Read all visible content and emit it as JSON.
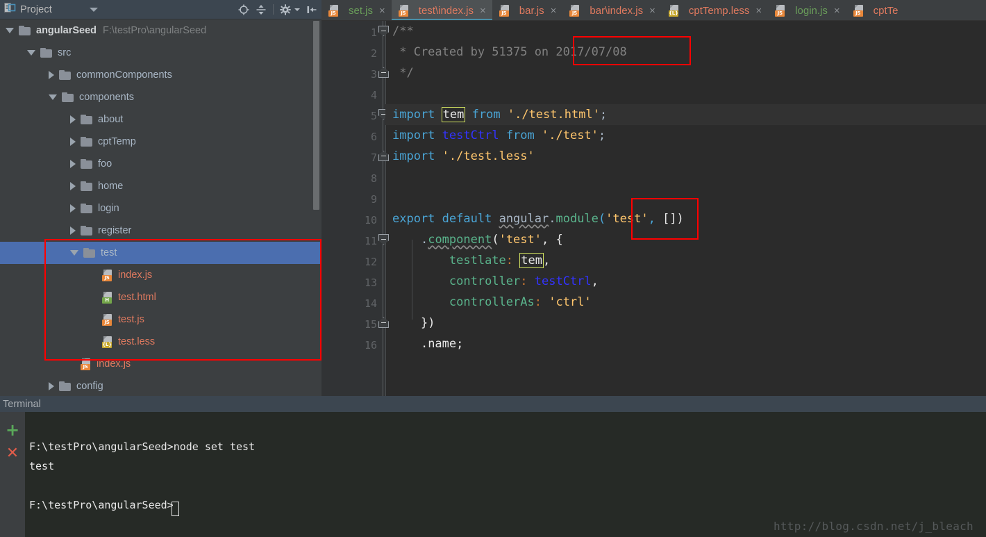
{
  "project_panel": {
    "title": "Project",
    "header_icons": [
      {
        "name": "project-view-selector-icon",
        "glyph": "▾"
      },
      {
        "name": "locate-in-tree-icon",
        "glyph": "⊕"
      },
      {
        "name": "collapse-all-icon",
        "glyph": "≕"
      },
      {
        "name": "settings-gear-icon",
        "glyph": "⚙"
      },
      {
        "name": "hide-panel-icon",
        "glyph": "⇤"
      }
    ],
    "tree": [
      {
        "label": "angularSeed",
        "path": "F:\\testPro\\angularSeed",
        "type": "project-root",
        "indent": 0,
        "state": "open",
        "icon": "folder"
      },
      {
        "label": "src",
        "type": "folder",
        "indent": 1,
        "state": "open",
        "icon": "folder"
      },
      {
        "label": "commonComponents",
        "type": "folder",
        "indent": 2,
        "state": "closed",
        "icon": "folder"
      },
      {
        "label": "components",
        "type": "folder",
        "indent": 2,
        "state": "open",
        "icon": "folder"
      },
      {
        "label": "about",
        "type": "folder",
        "indent": 3,
        "state": "closed",
        "icon": "folder"
      },
      {
        "label": "cptTemp",
        "type": "folder",
        "indent": 3,
        "state": "closed",
        "icon": "folder"
      },
      {
        "label": "foo",
        "type": "folder",
        "indent": 3,
        "state": "closed",
        "icon": "folder"
      },
      {
        "label": "home",
        "type": "folder",
        "indent": 3,
        "state": "closed",
        "icon": "folder"
      },
      {
        "label": "login",
        "type": "folder",
        "indent": 3,
        "state": "closed",
        "icon": "folder"
      },
      {
        "label": "register",
        "type": "folder",
        "indent": 3,
        "state": "closed",
        "icon": "folder"
      },
      {
        "label": "test",
        "type": "folder",
        "indent": 3,
        "state": "open",
        "icon": "folder",
        "selected": true
      },
      {
        "label": "index.js",
        "type": "file",
        "indent": 4,
        "icon": "js"
      },
      {
        "label": "test.html",
        "type": "file",
        "indent": 4,
        "icon": "html"
      },
      {
        "label": "test.js",
        "type": "file",
        "indent": 4,
        "icon": "js"
      },
      {
        "label": "test.less",
        "type": "file",
        "indent": 4,
        "icon": "less"
      },
      {
        "label": "index.js",
        "type": "file",
        "indent": 3,
        "icon": "js"
      },
      {
        "label": "config",
        "type": "folder",
        "indent": 2,
        "state": "closed",
        "icon": "folder"
      }
    ]
  },
  "editor": {
    "tabs": [
      {
        "label": "set.js",
        "icon": "js",
        "color": "green",
        "active": false,
        "closable": true
      },
      {
        "label": "test\\index.js",
        "icon": "js",
        "color": "red",
        "active": true,
        "closable": true
      },
      {
        "label": "bar.js",
        "icon": "js",
        "color": "red",
        "active": false,
        "closable": true
      },
      {
        "label": "bar\\index.js",
        "icon": "js",
        "color": "red",
        "active": false,
        "closable": true
      },
      {
        "label": "cptTemp.less",
        "icon": "less",
        "color": "red",
        "active": false,
        "closable": true
      },
      {
        "label": "login.js",
        "icon": "js",
        "color": "green",
        "active": false,
        "closable": true
      },
      {
        "label": "cptTe",
        "icon": "js",
        "color": "red",
        "active": false,
        "closable": false
      }
    ],
    "close_glyph": "×",
    "line_numbers": [
      "1",
      "2",
      "3",
      "4",
      "5",
      "6",
      "7",
      "8",
      "9",
      "10",
      "11",
      "12",
      "13",
      "14",
      "15",
      "16"
    ],
    "current_line": 5,
    "lines": [
      {
        "n": 1,
        "text": "/**"
      },
      {
        "n": 2,
        "text": " * Created by 51375 on 2017/07/08"
      },
      {
        "n": 3,
        "text": " */"
      },
      {
        "n": 4,
        "text": ""
      },
      {
        "n": 5,
        "text": "import tem from './test.html';"
      },
      {
        "n": 6,
        "text": "import testCtrl from './test';"
      },
      {
        "n": 7,
        "text": "import './test.less'"
      },
      {
        "n": 8,
        "text": ""
      },
      {
        "n": 9,
        "text": ""
      },
      {
        "n": 10,
        "text": "export default angular.module('test', [])"
      },
      {
        "n": 11,
        "text": "    .component('test', {"
      },
      {
        "n": 12,
        "text": "        testlate: tem,"
      },
      {
        "n": 13,
        "text": "        controller: testCtrl,"
      },
      {
        "n": 14,
        "text": "        controllerAs: 'ctrl'"
      },
      {
        "n": 15,
        "text": "    })"
      },
      {
        "n": 16,
        "text": "    .name;"
      }
    ],
    "highlighted_token": "tem"
  },
  "terminal": {
    "title": "Terminal",
    "new_session_glyph": "+",
    "close_session_glyph": "✕",
    "lines": [
      "F:\\testPro\\angularSeed>node set test",
      "test",
      "",
      "F:\\testPro\\angularSeed>"
    ]
  },
  "watermark": "http://blog.csdn.net/j_bleach",
  "annotations": {
    "color": "#ff0000",
    "boxes": [
      {
        "name": "date-annotation-box",
        "target": "2017/07/08"
      },
      {
        "name": "module-name-annotation-box",
        "target": "('test',"
      },
      {
        "name": "test-folder-annotation-box",
        "target": "test folder and its files"
      }
    ]
  },
  "colors": {
    "accent": "#4b6eaf",
    "tab_underline": "#4a8fa8",
    "panel_bg": "#3c3f41",
    "editor_bg": "#2b2b2b",
    "terminal_bg": "#262a26",
    "annotation_red": "#ff0000"
  }
}
